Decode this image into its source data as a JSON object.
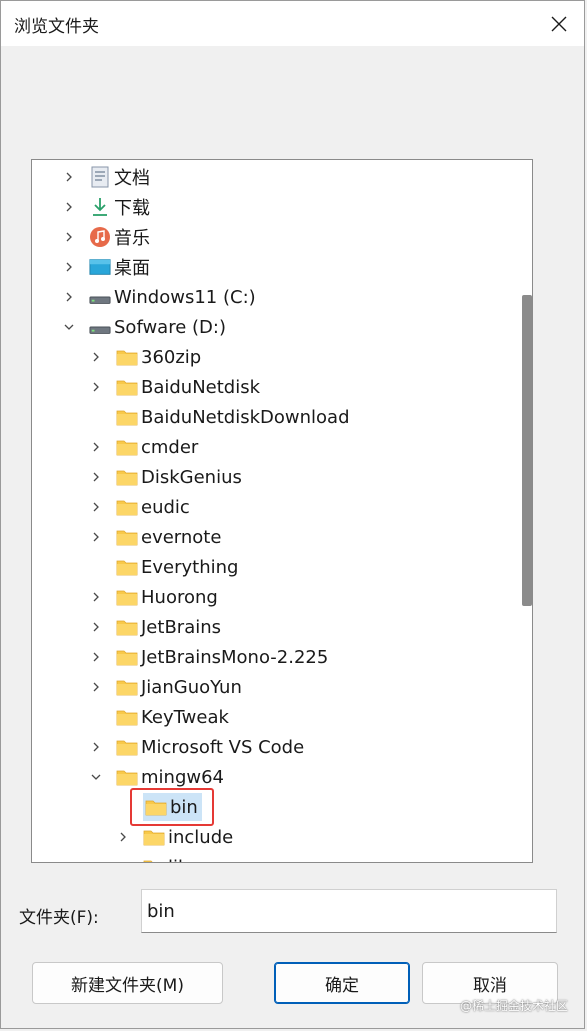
{
  "window": {
    "title": "浏览文件夹"
  },
  "tree": {
    "items": [
      {
        "label": "文档",
        "icon": "documents-icon",
        "chevron": "right"
      },
      {
        "label": "下载",
        "icon": "download-icon",
        "chevron": "right"
      },
      {
        "label": "音乐",
        "icon": "music-icon",
        "chevron": "right"
      },
      {
        "label": "桌面",
        "icon": "desktop-icon",
        "chevron": "right"
      },
      {
        "label": "Windows11 (C:)",
        "icon": "drive-icon",
        "chevron": "right"
      },
      {
        "label": "Sofware (D:)",
        "icon": "drive-icon",
        "chevron": "down"
      },
      {
        "label": "360zip",
        "icon": "folder-icon",
        "chevron": "right"
      },
      {
        "label": "BaiduNetdisk",
        "icon": "folder-icon",
        "chevron": "right"
      },
      {
        "label": "BaiduNetdiskDownload",
        "icon": "folder-icon",
        "chevron": "none"
      },
      {
        "label": "cmder",
        "icon": "folder-icon",
        "chevron": "right"
      },
      {
        "label": "DiskGenius",
        "icon": "folder-icon",
        "chevron": "right"
      },
      {
        "label": "eudic",
        "icon": "folder-icon",
        "chevron": "right"
      },
      {
        "label": "evernote",
        "icon": "folder-icon",
        "chevron": "right"
      },
      {
        "label": "Everything",
        "icon": "folder-icon",
        "chevron": "none"
      },
      {
        "label": "Huorong",
        "icon": "folder-icon",
        "chevron": "right"
      },
      {
        "label": "JetBrains",
        "icon": "folder-icon",
        "chevron": "right"
      },
      {
        "label": "JetBrainsMono-2.225",
        "icon": "folder-icon",
        "chevron": "right"
      },
      {
        "label": "JianGuoYun",
        "icon": "folder-icon",
        "chevron": "right"
      },
      {
        "label": "KeyTweak",
        "icon": "folder-icon",
        "chevron": "none"
      },
      {
        "label": "Microsoft VS Code",
        "icon": "folder-icon",
        "chevron": "right"
      },
      {
        "label": "mingw64",
        "icon": "folder-icon",
        "chevron": "down"
      },
      {
        "label": "bin",
        "icon": "folder-icon",
        "chevron": "none",
        "selected": true
      },
      {
        "label": "include",
        "icon": "folder-icon",
        "chevron": "right"
      },
      {
        "label": "lib",
        "icon": "folder-icon",
        "chevron": "right"
      }
    ]
  },
  "folder_field": {
    "label": "文件夹(F):",
    "value": "bin"
  },
  "buttons": {
    "new_folder": "新建文件夹(M)",
    "ok": "确定",
    "cancel": "取消"
  },
  "watermark": "@稀土掘金技术社区",
  "colors": {
    "selection": "#cce4f7",
    "highlight_border": "#e53935",
    "accent": "#005fb8",
    "folder": "#f8c94a"
  }
}
